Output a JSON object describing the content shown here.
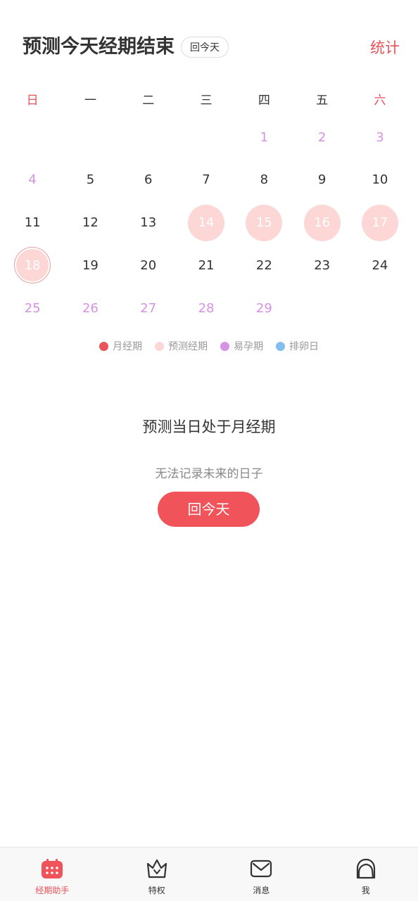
{
  "header": {
    "title": "预测今天经期结束",
    "today_chip": "回今天",
    "stats_link": "统计"
  },
  "weekdays": [
    "日",
    "一",
    "二",
    "三",
    "四",
    "五",
    "六"
  ],
  "calendar": {
    "rows": [
      [
        {
          "d": ""
        },
        {
          "d": ""
        },
        {
          "d": ""
        },
        {
          "d": ""
        },
        {
          "d": "1",
          "t": "fertile"
        },
        {
          "d": "2",
          "t": "fertile"
        },
        {
          "d": "3",
          "t": "fertile"
        }
      ],
      [
        {
          "d": "4",
          "t": "fertile"
        },
        {
          "d": "5"
        },
        {
          "d": "6"
        },
        {
          "d": "7"
        },
        {
          "d": "8"
        },
        {
          "d": "9"
        },
        {
          "d": "10"
        }
      ],
      [
        {
          "d": "11"
        },
        {
          "d": "12"
        },
        {
          "d": "13"
        },
        {
          "d": "14",
          "t": "predicted"
        },
        {
          "d": "15",
          "t": "predicted"
        },
        {
          "d": "16",
          "t": "predicted"
        },
        {
          "d": "17",
          "t": "predicted"
        }
      ],
      [
        {
          "d": "18",
          "t": "selected"
        },
        {
          "d": "19"
        },
        {
          "d": "20"
        },
        {
          "d": "21"
        },
        {
          "d": "22"
        },
        {
          "d": "23"
        },
        {
          "d": "24"
        }
      ],
      [
        {
          "d": "25",
          "t": "fertile"
        },
        {
          "d": "26",
          "t": "fertile"
        },
        {
          "d": "27",
          "t": "fertile"
        },
        {
          "d": "28",
          "t": "fertile"
        },
        {
          "d": "29",
          "t": "fertile"
        },
        {
          "d": ""
        },
        {
          "d": ""
        }
      ]
    ]
  },
  "legend": [
    {
      "label": "月经期",
      "color": "#ea5358"
    },
    {
      "label": "预测经期",
      "color": "#fcd7d6"
    },
    {
      "label": "易孕期",
      "color": "#d692e4"
    },
    {
      "label": "排卵日",
      "color": "#84bdf0"
    }
  ],
  "status": {
    "message": "预测当日处于月经期",
    "hint": "无法记录未来的日子",
    "button": "回今天"
  },
  "tabbar": {
    "items": [
      {
        "label": "经期助手",
        "icon": "calendar-icon",
        "active": true
      },
      {
        "label": "特权",
        "icon": "crown-icon"
      },
      {
        "label": "消息",
        "icon": "mail-icon"
      },
      {
        "label": "我",
        "icon": "user-icon"
      }
    ]
  },
  "colors": {
    "accent": "#e8515a",
    "button": "#f0545a",
    "fertile": "#d692e4",
    "predicted": "#fcd7d6"
  }
}
